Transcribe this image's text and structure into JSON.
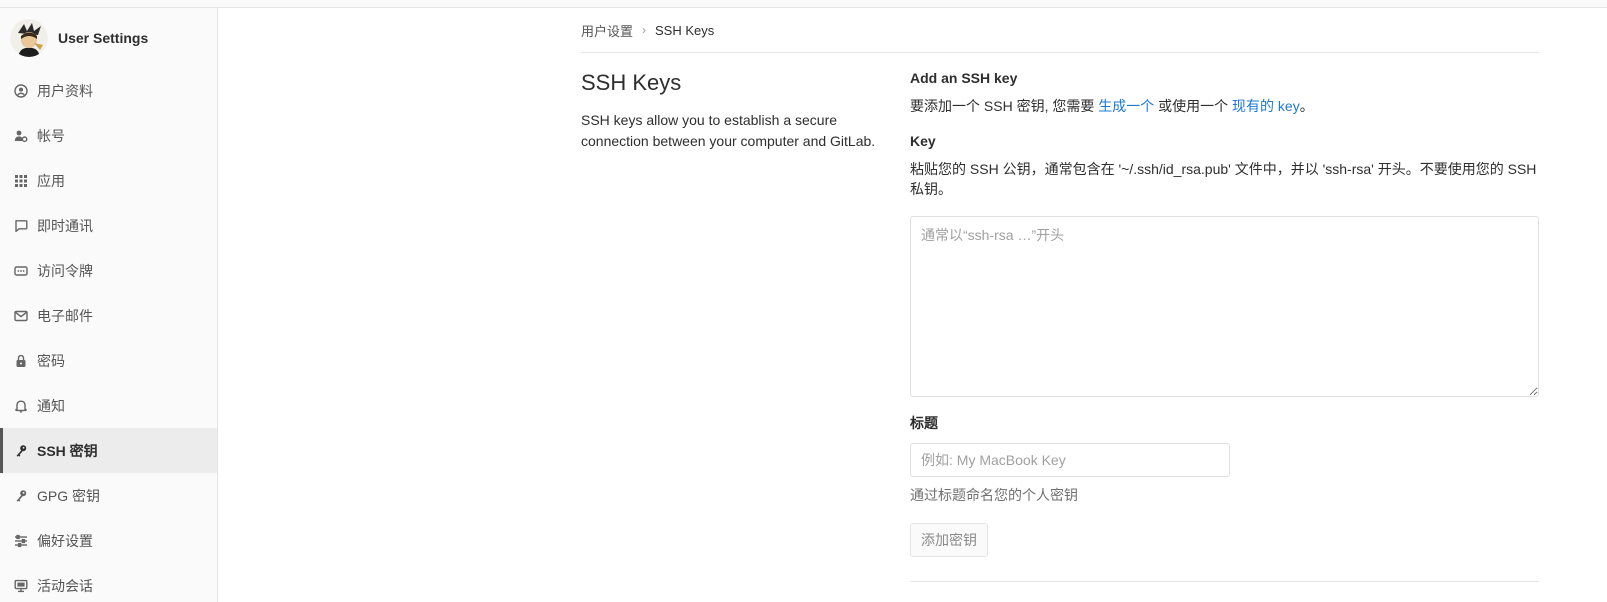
{
  "sidebar": {
    "title": "User Settings",
    "items": [
      {
        "label": "用户资料",
        "icon": "profile-icon"
      },
      {
        "label": "帐号",
        "icon": "account-icon"
      },
      {
        "label": "应用",
        "icon": "applications-icon"
      },
      {
        "label": "即时通讯",
        "icon": "chat-icon"
      },
      {
        "label": "访问令牌",
        "icon": "token-icon"
      },
      {
        "label": "电子邮件",
        "icon": "mail-icon"
      },
      {
        "label": "密码",
        "icon": "lock-icon"
      },
      {
        "label": "通知",
        "icon": "bell-icon"
      },
      {
        "label": "SSH 密钥",
        "icon": "key-icon",
        "active": true
      },
      {
        "label": "GPG 密钥",
        "icon": "key-icon"
      },
      {
        "label": "偏好设置",
        "icon": "preferences-icon"
      },
      {
        "label": "活动会话",
        "icon": "monitor-icon"
      }
    ]
  },
  "breadcrumb": {
    "parent": "用户设置",
    "current": "SSH Keys"
  },
  "intro": {
    "title": "SSH Keys",
    "description": "SSH keys allow you to establish a secure connection between your computer and GitLab."
  },
  "form": {
    "heading": "Add an SSH key",
    "help_prefix": "要添加一个 SSH 密钥, 您需要 ",
    "help_link1": "生成一个",
    "help_middle": " 或使用一个 ",
    "help_link2": "现有的 key",
    "help_suffix": "。",
    "key_label": "Key",
    "key_help": "粘贴您的 SSH 公钥，通常包含在 '~/.ssh/id_rsa.pub' 文件中，并以 'ssh-rsa' 开头。不要使用您的 SSH 私钥。",
    "key_placeholder": "通常以“ssh-rsa …”开头",
    "key_value": "",
    "title_label": "标题",
    "title_placeholder": "例如: My MacBook Key",
    "title_value": "",
    "title_help": "通过标题命名您的个人密钥",
    "submit_label": "添加密钥"
  },
  "colors": {
    "link": "#1f78d1",
    "sidebar_bg": "#fafafa",
    "active_bg": "#ececec"
  }
}
